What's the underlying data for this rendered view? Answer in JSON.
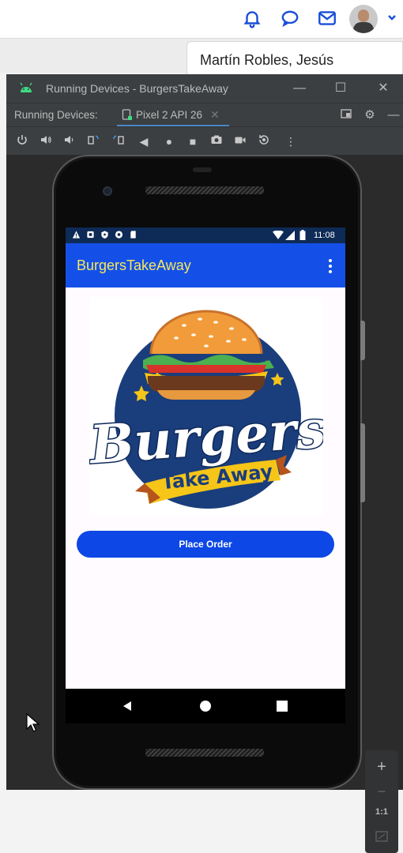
{
  "header": {
    "user_name": "Martín Robles, Jesús"
  },
  "window": {
    "title": "Running Devices - BurgersTakeAway",
    "tabs_label": "Running Devices:",
    "active_tab": "Pixel 2 API 26"
  },
  "device": {
    "status_time": "11:08",
    "app_title": "BurgersTakeAway",
    "logo": {
      "word": "Burgers",
      "ribbon": "Take Away"
    },
    "button_label": "Place Order"
  },
  "zoom": {
    "zoom_in": "+",
    "zoom_out": "−",
    "actual_size": "1:1"
  },
  "colors": {
    "accent_blue": "#1a4ed8",
    "appbar": "#1450e8",
    "app_title": "#f6e85c",
    "button": "#0d47e6"
  }
}
